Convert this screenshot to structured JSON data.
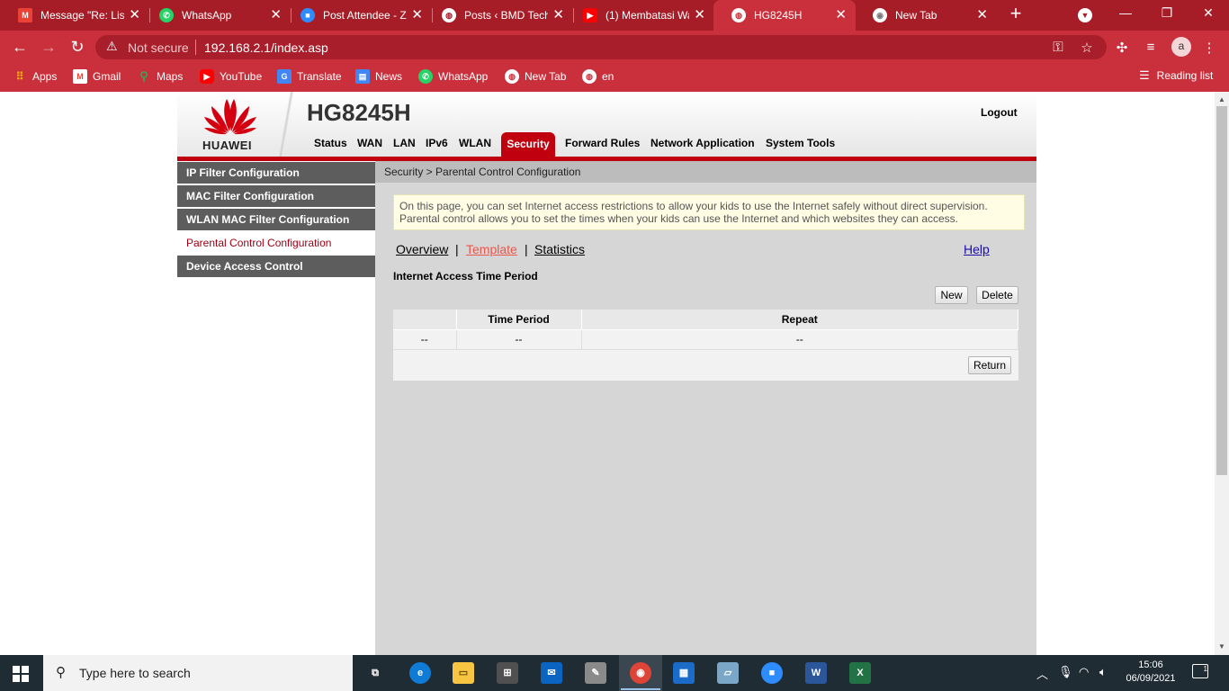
{
  "browser": {
    "tabs": [
      {
        "title": "Message \"Re: List",
        "icon": "gmail-icon",
        "color": "#EA4335",
        "glyph": "M"
      },
      {
        "title": "WhatsApp",
        "icon": "whatsapp-icon",
        "color": "#25D366",
        "glyph": "✆"
      },
      {
        "title": "Post Attendee - Z",
        "icon": "zoom-icon",
        "color": "#2D8CFF",
        "glyph": "■"
      },
      {
        "title": "Posts ‹ BMD Tech",
        "icon": "globe-icon",
        "color": "#555555",
        "glyph": "◍"
      },
      {
        "title": "(1) Membatasi Wa",
        "icon": "youtube-icon",
        "color": "#FF0000",
        "glyph": "▶"
      },
      {
        "title": "HG8245H",
        "icon": "globe-icon",
        "color": "#555555",
        "glyph": "◍"
      },
      {
        "title": "New Tab",
        "icon": "chrome-icon",
        "color": "#777777",
        "glyph": "◉"
      }
    ],
    "close_glyph": "✕",
    "new_tab_glyph": "+",
    "security_label": "Not secure",
    "url": "192.168.2.1/index.asp",
    "avatar_letter": "a",
    "bookmarks": [
      {
        "label": "Apps",
        "icon": "apps-grid-icon",
        "color": "#F4B400"
      },
      {
        "label": "Gmail",
        "icon": "gmail-icon",
        "color": "#EA4335"
      },
      {
        "label": "Maps",
        "icon": "maps-icon",
        "color": "#34A853"
      },
      {
        "label": "YouTube",
        "icon": "youtube-icon",
        "color": "#FF0000"
      },
      {
        "label": "Translate",
        "icon": "translate-icon",
        "color": "#4285F4"
      },
      {
        "label": "News",
        "icon": "news-icon",
        "color": "#4285F4"
      },
      {
        "label": "WhatsApp",
        "icon": "whatsapp-icon",
        "color": "#25D366"
      },
      {
        "label": "New Tab",
        "icon": "globe-icon",
        "color": "#ffffff"
      },
      {
        "label": "en",
        "icon": "globe-icon",
        "color": "#ffffff"
      }
    ],
    "reading_list": "Reading list"
  },
  "router": {
    "brand": "HUAWEI",
    "model": "HG8245H",
    "logout": "Logout",
    "menu": [
      "Status",
      "WAN",
      "LAN",
      "IPv6",
      "WLAN",
      "Security",
      "Forward Rules",
      "Network Application",
      "System Tools"
    ],
    "active_menu": "Security",
    "sidebar": [
      "IP Filter Configuration",
      "MAC Filter Configuration",
      "WLAN MAC Filter Configuration",
      "Parental Control Configuration",
      "Device Access Control"
    ],
    "active_sidebar": "Parental Control Configuration",
    "breadcrumb": "Security > Parental Control Configuration",
    "info_line1": "On this page, you can set Internet access restrictions to allow your kids to use the Internet safely without direct supervision.",
    "info_line2": "Parental control allows you to set the times when your kids can use the Internet and which websites they can access.",
    "subtabs": [
      "Overview",
      "Template",
      "Statistics"
    ],
    "current_subtab": "Template",
    "help": "Help",
    "section_title": "Internet Access Time Period",
    "btn_new": "New",
    "btn_delete": "Delete",
    "btn_return": "Return",
    "table": {
      "headers": [
        "",
        "Time Period",
        "Repeat"
      ],
      "rows": [
        [
          "--",
          "--",
          "--"
        ]
      ]
    },
    "colors": {
      "brand_red": "#C1000F",
      "sidebar_gray": "#5D5D5D",
      "content_gray": "#D6D6D6"
    }
  },
  "taskbar": {
    "search_placeholder": "Type here to search",
    "time": "15:06",
    "date": "06/09/2021",
    "apps": [
      {
        "icon": "task-view-icon",
        "color": "#202c34",
        "glyph": "⧉"
      },
      {
        "icon": "edge-icon",
        "color": "#0F7BD4",
        "glyph": "e"
      },
      {
        "icon": "file-explorer-icon",
        "color": "#F7C542",
        "glyph": "▭"
      },
      {
        "icon": "store-icon",
        "color": "#505050",
        "glyph": "⊞"
      },
      {
        "icon": "mail-icon",
        "color": "#0A64C2",
        "glyph": "✉"
      },
      {
        "icon": "paint-icon",
        "color": "#B0B0B0",
        "glyph": "✎"
      },
      {
        "icon": "chrome-icon",
        "color": "#DB4437",
        "glyph": "◉"
      },
      {
        "icon": "calendar-icon",
        "color": "#1B6BC8",
        "glyph": "▦"
      },
      {
        "icon": "notes-icon",
        "color": "#7AA7C7",
        "glyph": "▱"
      },
      {
        "icon": "zoom-icon",
        "color": "#2D8CFF",
        "glyph": "■"
      },
      {
        "icon": "word-icon",
        "color": "#2B579A",
        "glyph": "W"
      },
      {
        "icon": "excel-icon",
        "color": "#217346",
        "glyph": "X"
      }
    ]
  }
}
